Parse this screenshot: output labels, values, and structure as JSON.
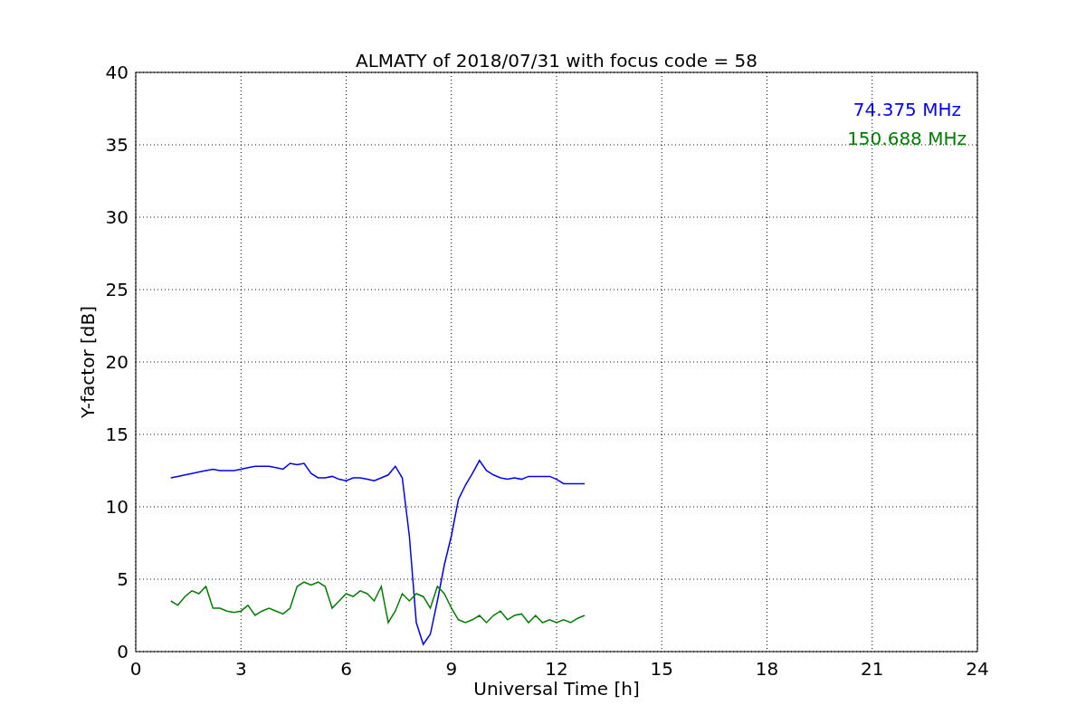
{
  "chart_data": {
    "type": "line",
    "title": "ALMATY of 2018/07/31 with focus code = 58",
    "xlabel": "Universal Time [h]",
    "ylabel": "Y-factor [dB]",
    "x": [
      1.0,
      1.2,
      1.4,
      1.6,
      1.8,
      2.0,
      2.2,
      2.4,
      2.6,
      2.8,
      3.0,
      3.2,
      3.4,
      3.6,
      3.8,
      4.0,
      4.2,
      4.4,
      4.6,
      4.8,
      5.0,
      5.2,
      5.4,
      5.6,
      5.8,
      6.0,
      6.2,
      6.4,
      6.6,
      6.8,
      7.0,
      7.2,
      7.4,
      7.6,
      7.8,
      8.0,
      8.2,
      8.4,
      8.6,
      8.8,
      9.0,
      9.2,
      9.4,
      9.6,
      9.8,
      10.0,
      10.2,
      10.4,
      10.6,
      10.8,
      11.0,
      11.2,
      11.4,
      11.6,
      11.8,
      12.0,
      12.2,
      12.4,
      12.6,
      12.8
    ],
    "series": [
      {
        "name": "74.375 MHz",
        "color": "#0000ff",
        "values": [
          12.0,
          12.1,
          12.2,
          12.3,
          12.4,
          12.5,
          12.6,
          12.5,
          12.5,
          12.5,
          12.6,
          12.7,
          12.8,
          12.8,
          12.8,
          12.7,
          12.6,
          13.0,
          12.9,
          13.0,
          12.3,
          12.0,
          12.0,
          12.1,
          11.9,
          11.8,
          12.0,
          12.0,
          11.9,
          11.8,
          12.0,
          12.2,
          12.8,
          12.0,
          8.0,
          2.0,
          0.5,
          1.2,
          3.5,
          6.0,
          8.0,
          10.5,
          11.5,
          12.3,
          13.2,
          12.5,
          12.2,
          12.0,
          11.9,
          12.0,
          11.9,
          12.1,
          12.1,
          12.1,
          12.1,
          11.9,
          11.6,
          11.6,
          11.6,
          11.6
        ]
      },
      {
        "name": "150.688 MHz",
        "color": "#008000",
        "values": [
          3.5,
          3.2,
          3.8,
          4.2,
          4.0,
          4.5,
          3.0,
          3.0,
          2.8,
          2.7,
          2.8,
          3.2,
          2.5,
          2.8,
          3.0,
          2.8,
          2.6,
          3.0,
          4.5,
          4.8,
          4.6,
          4.8,
          4.5,
          3.0,
          3.5,
          4.0,
          3.8,
          4.2,
          4.0,
          3.5,
          4.5,
          2.0,
          2.8,
          4.0,
          3.5,
          4.0,
          3.8,
          3.0,
          4.5,
          4.0,
          3.0,
          2.2,
          2.0,
          2.2,
          2.5,
          2.0,
          2.5,
          2.8,
          2.2,
          2.5,
          2.6,
          2.0,
          2.5,
          2.0,
          2.2,
          2.0,
          2.2,
          2.0,
          2.3,
          2.5
        ]
      }
    ],
    "xlim": [
      0,
      24
    ],
    "ylim": [
      0,
      40
    ],
    "xticks": [
      0,
      3,
      6,
      9,
      12,
      15,
      18,
      21,
      24
    ],
    "yticks": [
      0,
      5,
      10,
      15,
      20,
      25,
      30,
      35,
      40
    ],
    "grid": true
  }
}
